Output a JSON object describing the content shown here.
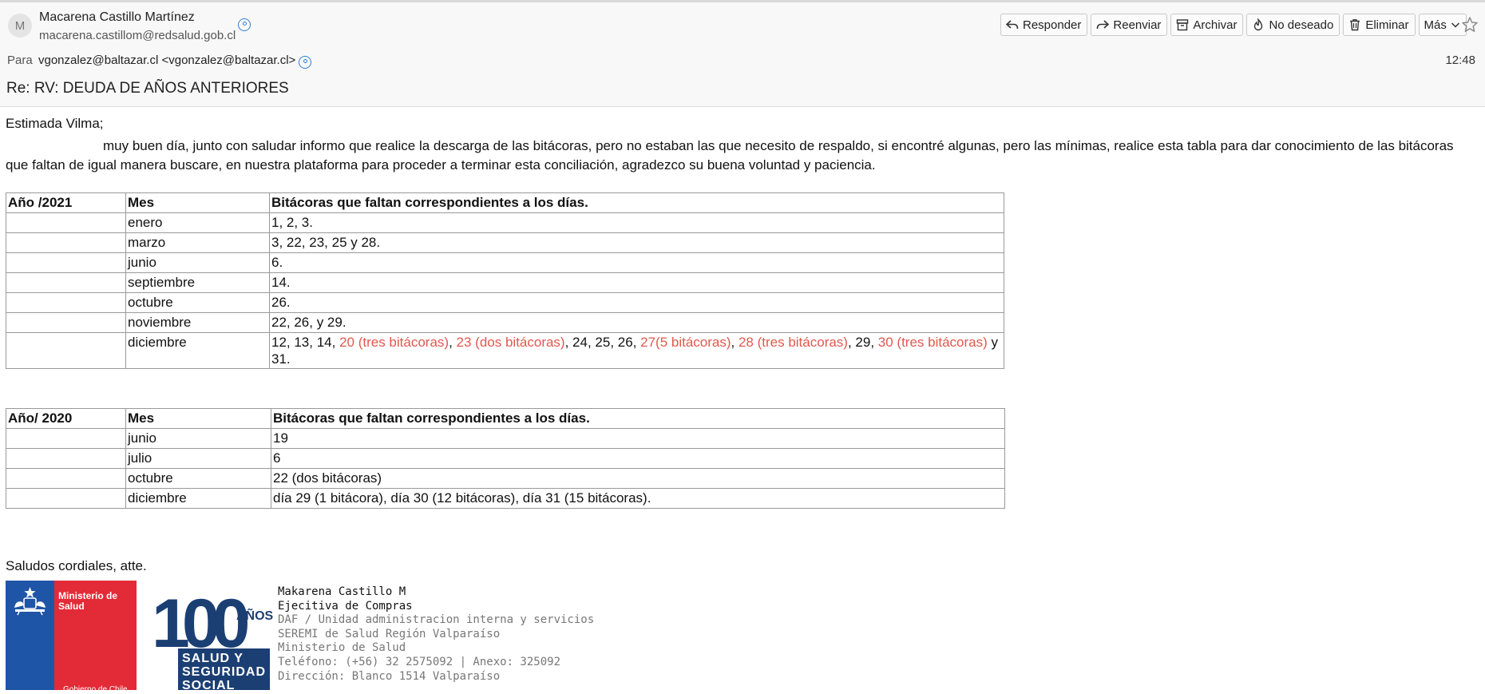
{
  "header": {
    "avatar_letter": "M",
    "sender_name": "Macarena Castillo Martínez",
    "sender_email": "macarena.castillom@redsalud.gob.cl",
    "to_label": "Para",
    "to_value": "vgonzalez@baltazar.cl <vgonzalez@baltazar.cl>",
    "subject": "Re: RV: DEUDA DE AÑOS ANTERIORES",
    "time": "12:48",
    "toolbar": {
      "reply": "Responder",
      "forward": "Reenviar",
      "archive": "Archivar",
      "junk": "No deseado",
      "delete": "Eliminar",
      "more": "Más"
    }
  },
  "body": {
    "greeting": "Estimada Vilma;",
    "paragraph": "muy buen día, junto con saludar informo que realice la descarga de las bitácoras, pero no estaban las que necesito de respaldo, si encontré algunas, pero las mínimas, realice esta tabla para dar conocimiento de las bitácoras que faltan de igual manera buscare, en nuestra plataforma para proceder a terminar esta conciliación, agradezco su buena voluntad y paciencia.",
    "table2021": {
      "headers": [
        "Año /2021",
        "Mes",
        "Bitácoras que faltan correspondientes a los días."
      ],
      "rows": [
        [
          "",
          "enero",
          "1, 2, 3."
        ],
        [
          "",
          "marzo",
          "3, 22, 23, 25 y 28."
        ],
        [
          "",
          "junio",
          "6."
        ],
        [
          "",
          "septiembre",
          "14."
        ],
        [
          "",
          "octubre",
          "26."
        ],
        [
          "",
          "noviembre",
          "22, 26, y 29."
        ],
        [
          "",
          "diciembre",
          ""
        ]
      ],
      "dec_segments": [
        {
          "text": "12, 13, 14, ",
          "red": false
        },
        {
          "text": "20 (tres bitácoras)",
          "red": true
        },
        {
          "text": ", ",
          "red": false
        },
        {
          "text": "23 (dos bitácoras)",
          "red": true
        },
        {
          "text": ", 24, 25, 26, ",
          "red": false
        },
        {
          "text": "27(5 bitácoras)",
          "red": true
        },
        {
          "text": ", ",
          "red": false
        },
        {
          "text": "28 (tres bitácoras)",
          "red": true
        },
        {
          "text": ", 29, ",
          "red": false
        },
        {
          "text": "30 (tres bitácoras)",
          "red": true
        },
        {
          "text": " y 31.",
          "red": false
        }
      ]
    },
    "table2020": {
      "headers": [
        "Año/ 2020",
        "Mes",
        "Bitácoras que faltan correspondientes a los días."
      ],
      "rows": [
        [
          "",
          "junio",
          "19"
        ],
        [
          "",
          "julio",
          "6"
        ],
        [
          "",
          "octubre",
          "22 (dos bitácoras)"
        ],
        [
          "",
          "diciembre",
          "día 29 (1 bitácora), día 30 (12 bitácoras), día 31 (15 bitácoras)."
        ]
      ]
    },
    "closing": "Saludos cordiales, atte."
  },
  "signature": {
    "logo_ministry": "Ministerio de Salud",
    "logo_gov": "Gobierno de Chile",
    "logo100_number": "100",
    "logo100_years": "AÑOS",
    "logo100_lines": [
      "SALUD Y",
      "SEGURIDAD",
      "SOCIAL"
    ],
    "name": "Makarena Castillo M",
    "role": "Ejecitiva de Compras",
    "lines": [
      "DAF / Unidad administracion interna y servicios",
      "SEREMI de Salud Región Valparaíso",
      "Ministerio de Salud",
      "Teléfono: (+56) 32 2575092 | Anexo: 325092",
      "Dirección: Blanco 1514 Valparaíso"
    ]
  },
  "colors": {
    "accent_blue": "#2f7fd6",
    "highlight_red": "#e0584e",
    "ministry_blue": "#1e55a6",
    "ministry_red": "#e32a37",
    "logo100_navy": "#1b3f73"
  }
}
